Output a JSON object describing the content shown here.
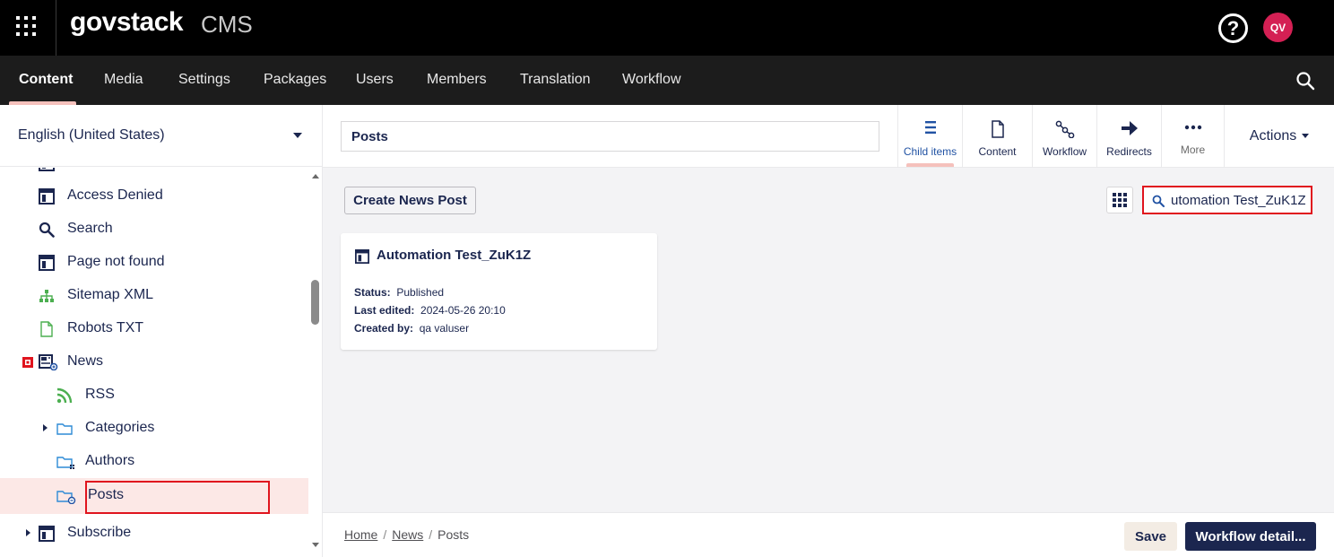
{
  "header": {
    "logo": "govstack",
    "logo_suffix": "CMS",
    "help_icon": "help-icon",
    "avatar_initials": "QV"
  },
  "nav": {
    "items": [
      "Content",
      "Media",
      "Settings",
      "Packages",
      "Users",
      "Members",
      "Translation",
      "Workflow"
    ],
    "active": "Content",
    "accent": "#f5c1bc"
  },
  "sidebar": {
    "culture": "English (United States)",
    "tree": [
      {
        "label": "Access Denied",
        "icon": "layout-icon"
      },
      {
        "label": "Search",
        "icon": "search-icon"
      },
      {
        "label": "Page not found",
        "icon": "layout-icon"
      },
      {
        "label": "Sitemap XML",
        "icon": "sitemap-icon"
      },
      {
        "label": "Robots TXT",
        "icon": "document-icon"
      },
      {
        "label": "News",
        "icon": "news-icon"
      },
      {
        "label": "RSS",
        "icon": "rss-icon"
      },
      {
        "label": "Categories",
        "icon": "folder-icon"
      },
      {
        "label": "Authors",
        "icon": "folder-icon"
      },
      {
        "label": "Posts",
        "icon": "folder-icon"
      },
      {
        "label": "Subscribe",
        "icon": "layout-icon"
      }
    ],
    "selected": "Posts",
    "selected_bg": "#fce8e6"
  },
  "editor": {
    "name": "Posts",
    "tabs": [
      {
        "label": "Child items",
        "icon": "list-icon"
      },
      {
        "label": "Content",
        "icon": "document-icon"
      },
      {
        "label": "Workflow",
        "icon": "workflow-icon"
      },
      {
        "label": "Redirects",
        "icon": "arrow-right-icon"
      },
      {
        "label": "More",
        "icon": "more-icon"
      }
    ],
    "active_tab": "Child items",
    "actions_label": "Actions"
  },
  "list": {
    "create_label": "Create News Post",
    "search_value": "utomation Test_ZuK1Z",
    "items": [
      {
        "name": "Automation Test_ZuK1Z",
        "status_label": "Status:",
        "status": "Published",
        "edited_label": "Last edited:",
        "edited": "2024-05-26 20:10",
        "created_label": "Created by:",
        "created_by": "qa valuser"
      }
    ]
  },
  "footer": {
    "breadcrumb": [
      "Home",
      "News",
      "Posts"
    ],
    "save_label": "Save",
    "workflow_label": "Workflow detail...",
    "primary_color": "#1b264f"
  }
}
